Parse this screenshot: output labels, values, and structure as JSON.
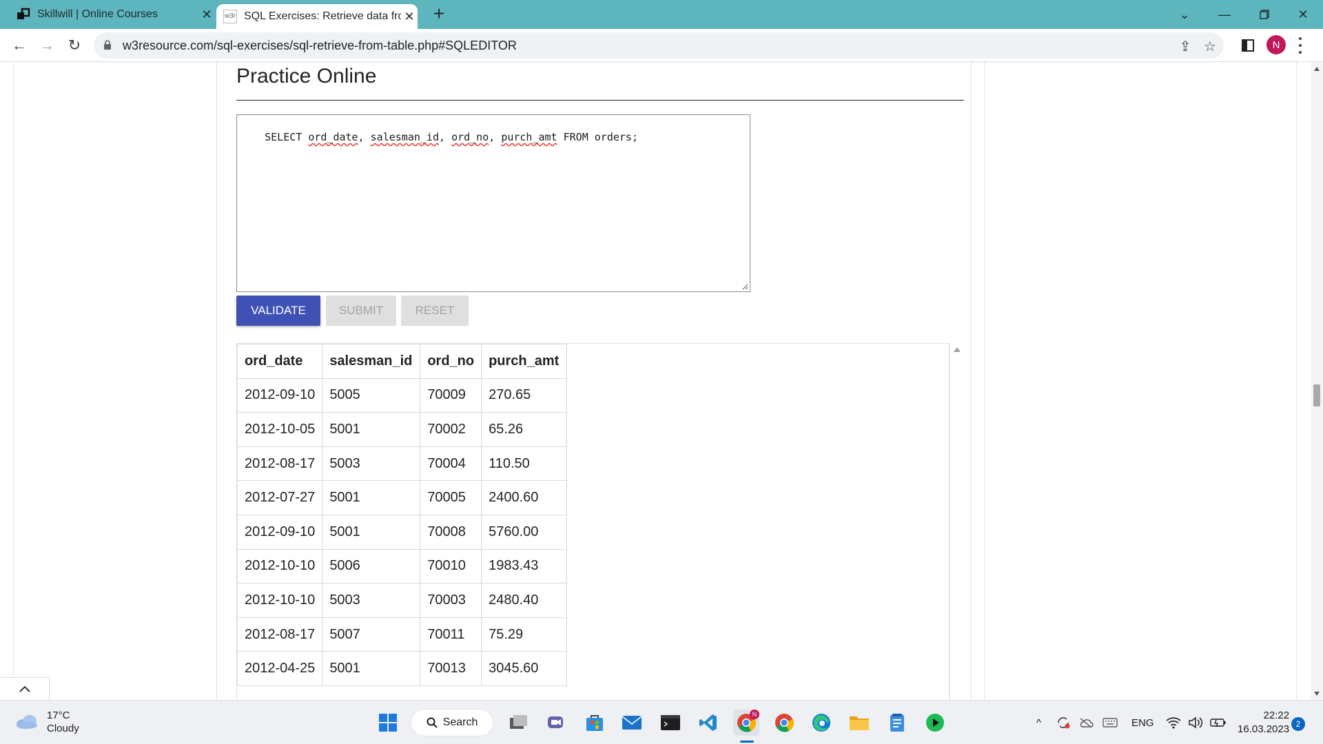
{
  "browser": {
    "tabs": [
      {
        "title": "Skillwill | Online Courses",
        "favicon": "skillwill-logo-icon",
        "active": false
      },
      {
        "title": "SQL Exercises: Retrieve data from",
        "favicon": "w3r-favicon",
        "favicon_text": "w3r",
        "active": true
      }
    ],
    "url": "w3resource.com/sql-exercises/sql-retrieve-from-table.php#SQLEDITOR",
    "profile_initial": "N",
    "accent_color": "#5db5bd"
  },
  "page": {
    "title": "Practice Online",
    "editor": {
      "parts": [
        {
          "text": "SELECT ",
          "squiggle": false
        },
        {
          "text": "ord_date",
          "squiggle": true
        },
        {
          "text": ", ",
          "squiggle": false
        },
        {
          "text": "salesman_id",
          "squiggle": true
        },
        {
          "text": ", ",
          "squiggle": false
        },
        {
          "text": "ord_no",
          "squiggle": true
        },
        {
          "text": ", ",
          "squiggle": false
        },
        {
          "text": "purch_amt",
          "squiggle": true
        },
        {
          "text": " FROM orders;",
          "squiggle": false
        }
      ]
    },
    "buttons": {
      "validate": "VALIDATE",
      "submit": "SUBMIT",
      "reset": "RESET"
    },
    "results": {
      "columns": [
        "ord_date",
        "salesman_id",
        "ord_no",
        "purch_amt"
      ],
      "rows": [
        [
          "2012-09-10",
          "5005",
          "70009",
          "270.65"
        ],
        [
          "2012-10-05",
          "5001",
          "70002",
          "65.26"
        ],
        [
          "2012-08-17",
          "5003",
          "70004",
          "110.50"
        ],
        [
          "2012-07-27",
          "5001",
          "70005",
          "2400.60"
        ],
        [
          "2012-09-10",
          "5001",
          "70008",
          "5760.00"
        ],
        [
          "2012-10-10",
          "5006",
          "70010",
          "1983.43"
        ],
        [
          "2012-10-10",
          "5003",
          "70003",
          "2480.40"
        ],
        [
          "2012-08-17",
          "5007",
          "70011",
          "75.29"
        ],
        [
          "2012-04-25",
          "5001",
          "70013",
          "3045.60"
        ]
      ]
    },
    "colors": {
      "validate_bg": "#3f51b5",
      "disabled_bg": "#dfdfdf"
    }
  },
  "taskbar": {
    "weather": {
      "temp": "17°C",
      "condition": "Cloudy"
    },
    "search_label": "Search",
    "language": "ENG",
    "time": "22:22",
    "date": "16.03.2023",
    "notifications": "2",
    "chrome_badge": "N"
  }
}
